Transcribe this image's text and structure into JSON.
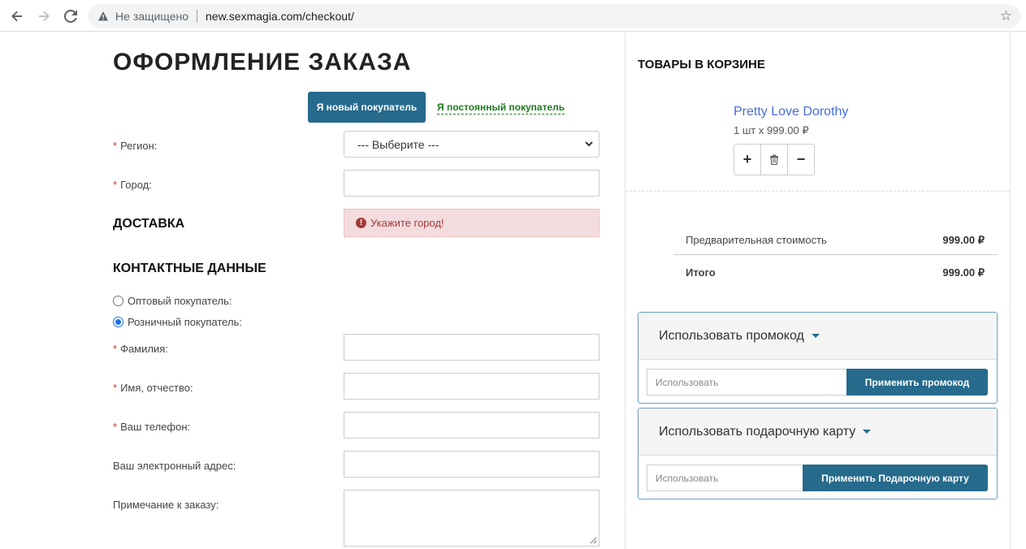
{
  "browser": {
    "security_label": "Не защищено",
    "url": "new.sexmagia.com/checkout/"
  },
  "checkout": {
    "title": "ОФОРМЛЕНИЕ ЗАКАЗА",
    "tabs": {
      "new_customer": "Я новый покупатель",
      "returning_customer": "Я постоянный покупатель"
    },
    "region_label": "Регион:",
    "region_value": "--- Выберите ---",
    "city_label": "Город:",
    "delivery_heading": "ДОСТАВКА",
    "city_error": "Укажите город!",
    "contacts_heading": "КОНТАКТНЫЕ ДАННЫЕ",
    "buyer_types": [
      {
        "label": "Оптовый покупатель:",
        "checked": false
      },
      {
        "label": "Розничный покупатель:",
        "checked": true
      }
    ],
    "fields": {
      "lastname": "Фамилия:",
      "firstname": "Имя, отчество:",
      "phone": "Ваш телефон:",
      "email": "Ваш электронный адрес:",
      "comment": "Примечание к заказу:"
    }
  },
  "cart": {
    "title": "ТОВАРЫ В КОРЗИНЕ",
    "product_name": "Pretty Love Dorothy",
    "product_qty": "1 шт x 999.00 ₽",
    "subtotal_label": "Предварительная стоимость",
    "subtotal_value": "999.00 ₽",
    "total_label": "Итого",
    "total_value": "999.00 ₽",
    "promo": {
      "title": "Использовать промокод",
      "placeholder": "Использовать",
      "button": "Применить промокод"
    },
    "gift": {
      "title": "Использовать подарочную карту",
      "placeholder": "Использовать",
      "button": "Применить Подарочную карту"
    }
  },
  "colors": {
    "accent": "#266a8c",
    "error_bg": "#f3dcde",
    "link_green": "#1f7a1f",
    "product_link": "#4a6fd8"
  }
}
